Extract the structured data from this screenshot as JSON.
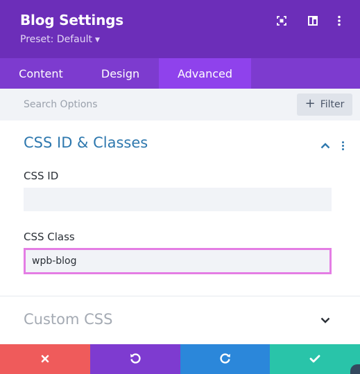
{
  "header": {
    "title": "Blog Settings",
    "preset_label": "Preset: Default",
    "icons": [
      "expand-icon",
      "split-view-icon",
      "more-icon"
    ],
    "background": "#6c2eb9"
  },
  "tabs": [
    {
      "label": "Content",
      "active": false
    },
    {
      "label": "Design",
      "active": false
    },
    {
      "label": "Advanced",
      "active": true
    }
  ],
  "search": {
    "placeholder": "Search Options",
    "filter_label": "Filter"
  },
  "sections": {
    "css_id_classes": {
      "title": "CSS ID & Classes",
      "expanded": true,
      "css_id_label": "CSS ID",
      "css_id_value": "",
      "css_class_label": "CSS Class",
      "css_class_value": "wpb-blog"
    },
    "custom_css": {
      "title": "Custom CSS",
      "expanded": false
    }
  },
  "footer": {
    "buttons": [
      {
        "name": "discard",
        "icon": "close-icon",
        "color": "#ef5b5b"
      },
      {
        "name": "undo",
        "icon": "undo-icon",
        "color": "#7e3bd0"
      },
      {
        "name": "redo",
        "icon": "redo-icon",
        "color": "#2b87da"
      },
      {
        "name": "save",
        "icon": "check-icon",
        "color": "#29c4a9"
      }
    ]
  },
  "colors": {
    "accent": "#2e78ae",
    "focus_border": "#e47de4",
    "active_tab": "#8f42ec"
  }
}
